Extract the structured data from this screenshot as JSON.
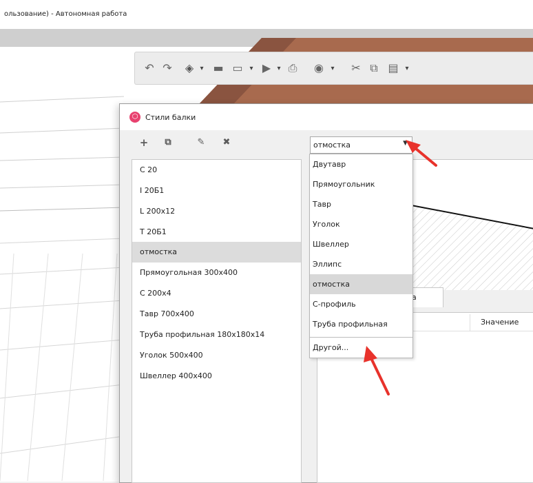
{
  "window": {
    "title": "ользование) - Автономная работа"
  },
  "toolbar": {
    "icons": [
      "undo-icon",
      "redo-icon",
      "3d-view-icon",
      "open-folder-icon",
      "save-icon",
      "export-icon",
      "print-icon",
      "render-icon",
      "cut-icon",
      "copy-icon",
      "paste-icon"
    ]
  },
  "dialog": {
    "title": "Стили балки",
    "list_toolbar": {
      "add": "+",
      "copy": "⧉",
      "edit": "✎",
      "delete": "✖"
    },
    "styles": [
      "С 20",
      "I 20Б1",
      "L 200x12",
      "Т 20Б1",
      "отмостка",
      "Прямоугольная 300x400",
      "С 200x4",
      "Тавр 700x400",
      "Труба профильная 180x180x14",
      "Уголок 500x400",
      "Швеллер 400x400"
    ],
    "selected_style": "отмостка",
    "profile_combo": {
      "value": "отмостка"
    },
    "dropdown": {
      "items": [
        "Двутавр",
        "Прямоугольник",
        "Тавр",
        "Уголок",
        "Швеллер",
        "Эллипс",
        "отмостка",
        "С-профиль",
        "Труба профильная"
      ],
      "selected": "отмостка",
      "other": "Другой..."
    },
    "tab_partial": "ства",
    "table": {
      "value_header": "Значение"
    }
  },
  "colors": {
    "accent_arrow": "#e8322b",
    "roof": "#a86a4e",
    "selection": "#dcdcdc",
    "icon_pink": "#e8416f"
  }
}
